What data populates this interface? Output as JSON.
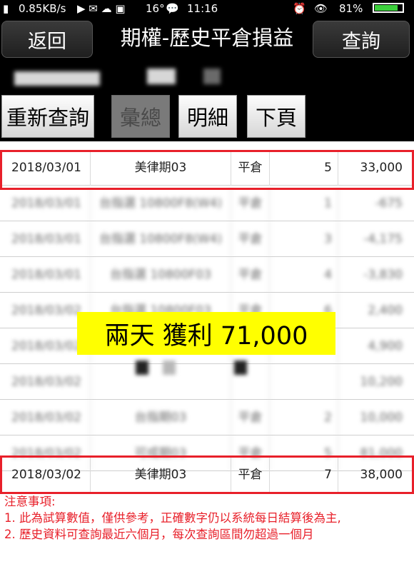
{
  "status_bar": {
    "net_speed": "0.85KB/s",
    "temp": "16°",
    "time": "11:16",
    "battery": "81%"
  },
  "header": {
    "back_label": "返回",
    "title": "期權-歷史平倉損益",
    "query_label": "查詢"
  },
  "tabs": {
    "requery": "重新查詢",
    "summary": "彙總",
    "detail": "明細",
    "next_page": "下頁"
  },
  "rows": [
    {
      "date": "2018/03/01",
      "contract": "美律期03",
      "type": "平倉",
      "qty": "5",
      "pl": "33,000"
    },
    {
      "date": "2018/03/01",
      "contract": "台指選 10800F8(W4)",
      "type": "平倉",
      "qty": "1",
      "pl": "-675"
    },
    {
      "date": "2018/03/01",
      "contract": "台指選 10800F8(W4)",
      "type": "平倉",
      "qty": "3",
      "pl": "-4,175"
    },
    {
      "date": "2018/03/01",
      "contract": "台指選 10800F03",
      "type": "平倉",
      "qty": "4",
      "pl": "-3,830"
    },
    {
      "date": "2018/03/02",
      "contract": "台指選 10800F03",
      "type": "平倉",
      "qty": "6",
      "pl": "2,400"
    },
    {
      "date": "2018/03/02",
      "contract": "",
      "type": "",
      "qty": "",
      "pl": "4,900"
    },
    {
      "date": "2018/03/02",
      "contract": "",
      "type": "",
      "qty": "",
      "pl": "10,200"
    },
    {
      "date": "2018/03/02",
      "contract": "台指期03",
      "type": "平倉",
      "qty": "2",
      "pl": "10,000"
    },
    {
      "date": "2018/03/02",
      "contract": "可成期03",
      "type": "平倉",
      "qty": "5",
      "pl": "81,000"
    },
    {
      "date": "2018/03/02",
      "contract": "美律期03",
      "type": "平倉",
      "qty": "7",
      "pl": "38,000"
    }
  ],
  "banner": "兩天 獲利 71,000",
  "notes": {
    "heading": "注意事項:",
    "line1": "1. 此為試算數值，僅供參考，正確數字仍以系統每日結算後為主,",
    "line2": "2. 歷史資料可查詢最近六個月，每次查詢區間勿超過一個月"
  }
}
